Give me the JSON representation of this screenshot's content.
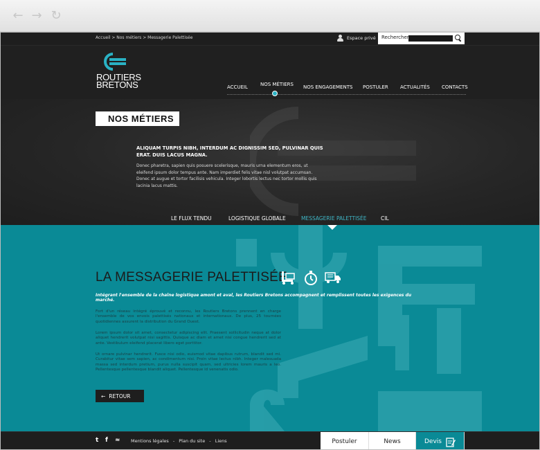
{
  "browser": {
    "back_icon": "arrow-left-icon",
    "forward_icon": "arrow-right-icon",
    "reload_icon": "reload-icon"
  },
  "topbar": {
    "breadcrumb": "Accueil  >  Nos métiers > Messagerie Palettisée",
    "espace_label": "Espace privé",
    "search_label": "Rechercher",
    "search_value": ""
  },
  "header": {
    "logo_line1": "ROUTIERS",
    "logo_line2": "BRETONS",
    "nav": [
      "ACCUEIL",
      "NOS MÉTIERS",
      "NOS ENGAGEMENTS",
      "POSTULER",
      "ACTUALITÉS",
      "CONTACTS"
    ],
    "active_nav": "NOS MÉTIERS"
  },
  "hero": {
    "title": "NOS MÉTIERS",
    "lead": "ALIQUAM TURPIS NIBH, INTERDUM AC DIGNISSIM SED, PULVINAR QUIS ERAT. DUIS LACUS MAGNA.",
    "body": "Donec pharetra, sapien quis posuere scelerisque, mauris urna elementum eros, ut eleifend ipsum dolor tempus ante. Nam imperdiet felis vitae nisl volutpat accumsan. Donec at augue et tortor facilisis vehicula. Integer lobortis lectus nec tortor mollis quis lacinia lacus mattis."
  },
  "subnav": {
    "items": [
      "LE FLUX TENDU",
      "LOGISTIQUE GLOBALE",
      "MESSAGERIE PALETTISÉE",
      "CIL"
    ],
    "active": "MESSAGERIE PALETTISÉE"
  },
  "section": {
    "title": "LA MESSAGERIE PALETTISÉE",
    "icons": [
      "pallet-truck-icon",
      "stopwatch-icon",
      "delivery-truck-icon"
    ],
    "intro": "Intégrant l'ensemble de la chaîne logistique amont et aval, les Routiers Bretons accompagnent et remplissent toutes les exigences du marché.",
    "paragraphs": [
      "Fort d'un réseau intégré éprouvé et reconnu, les Routiers Bretons prennent en charge l'ensemble de vos envois palettisés nationaux et internationaux. De plus, 25 tournées quotidiennes assurent la distribution du Grand Ouest.",
      "Lorem ipsum dolor sit amet, consectetur adipiscing elit. Praesent sollicitudin neque at dolor aliquet hendrerit volutpat nisi sagittis. Quisque ac diam et amet nisi congue hendrerit sed at ante. Vestibulum eleifend placerat libero eget porttitor.",
      "Ut ornare pulvinar hendrerit. Fusce nisi odio, euismod vitae dapibus rutrum, blandit sed mi. Curabitur vitae sem sapien, ac condimentum nisi. Proin vitae lectus nibh. Integer malesuada massa sed interdum pretium, purus nulla suscipit quam, sed ultricies lorem mauris a leo. Pellentesque pellentesque blandit aliquet. Pellentesque id venenatis odio."
    ],
    "back_label": "RETOUR"
  },
  "footer": {
    "social": [
      "twitter-icon",
      "facebook-icon",
      "rss-icon"
    ],
    "links": [
      "Mentions légales",
      "Plan du site",
      "Liens"
    ],
    "separator": "-",
    "tabs": [
      "Postuler",
      "News",
      "Devis"
    ]
  },
  "colors": {
    "teal": "#0a8a96",
    "accent": "#3fb6c6",
    "dark": "#1e1e1e"
  }
}
